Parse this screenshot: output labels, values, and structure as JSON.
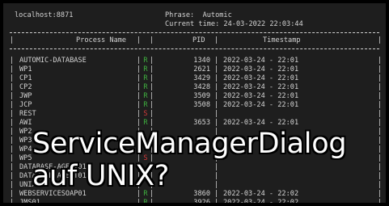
{
  "header": {
    "host": "localhost:8871",
    "phrase_line": "Phrase:  Automic",
    "time_line": "Current time: 24-03-2022 22:03:44"
  },
  "table": {
    "col_name": "Process Name",
    "col_pid": "PID",
    "col_timestamp": "Timestamp",
    "rows": [
      {
        "name": "AUTOMIC-DATABASE",
        "status": "R",
        "pid": "1340",
        "ts": "2022-03-24 - 22:01"
      },
      {
        "name": "WP1",
        "status": "R",
        "pid": "2621",
        "ts": "2022-03-24 - 22:01"
      },
      {
        "name": "CP1",
        "status": "R",
        "pid": "3429",
        "ts": "2022-03-24 - 22:01"
      },
      {
        "name": "CP2",
        "status": "R",
        "pid": "3428",
        "ts": "2022-03-24 - 22:01"
      },
      {
        "name": "JWP",
        "status": "R",
        "pid": "3509",
        "ts": "2022-03-24 - 22:01"
      },
      {
        "name": "JCP",
        "status": "R",
        "pid": "3508",
        "ts": "2022-03-24 - 22:01"
      },
      {
        "name": "REST",
        "status": "S",
        "pid": "",
        "ts": ""
      },
      {
        "name": "AWI",
        "status": "R",
        "pid": "3653",
        "ts": "2022-03-24 - 22:01"
      },
      {
        "name": "WP2",
        "status": "",
        "pid": "",
        "ts": ""
      },
      {
        "name": "WP3",
        "status": "",
        "pid": "",
        "ts": ""
      },
      {
        "name": "WP4",
        "status": "",
        "pid": "",
        "ts": ""
      },
      {
        "name": "WP5",
        "status": "S",
        "pid": "",
        "ts": ""
      },
      {
        "name": "DATABASE-AGENT01",
        "status": "",
        "pid": "",
        "ts": ""
      },
      {
        "name": "DATABASE-AGENT01",
        "status": "",
        "pid": "",
        "ts": ""
      },
      {
        "name": "UNIX",
        "status": "",
        "pid": "",
        "ts": ""
      },
      {
        "name": "WEBSERVICESOAP01",
        "status": "R",
        "pid": "3860",
        "ts": "2022-03-24 - 22:02"
      },
      {
        "name": "JMS01",
        "status": "R",
        "pid": "3926",
        "ts": "2022-03-24 - 22:02"
      }
    ]
  },
  "overlay": {
    "line1": "ServiceManagerDialog",
    "line2": "auf UNIX?"
  },
  "colors": {
    "running": "#3fb13f",
    "stopped": "#d23a3a",
    "background": "#1e1e1e",
    "text": "#d4d4d4"
  }
}
